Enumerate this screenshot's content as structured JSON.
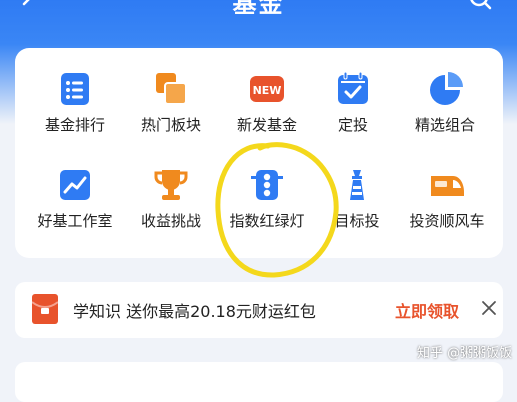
{
  "header": {
    "title": "基金"
  },
  "grid": {
    "items": [
      {
        "label": "基金排行",
        "icon": "ranking-list-icon"
      },
      {
        "label": "热门板块",
        "icon": "hot-sectors-icon"
      },
      {
        "label": "新发基金",
        "icon": "new-fund-icon",
        "badge": "NEW"
      },
      {
        "label": "定投",
        "icon": "calendar-check-icon"
      },
      {
        "label": "精选组合",
        "icon": "pie-chart-icon"
      },
      {
        "label": "好基工作室",
        "icon": "trend-chart-icon"
      },
      {
        "label": "收益挑战",
        "icon": "trophy-icon"
      },
      {
        "label": "指数红绿灯",
        "icon": "traffic-light-icon"
      },
      {
        "label": "目标投",
        "icon": "lighthouse-icon"
      },
      {
        "label": "投资顺风车",
        "icon": "train-icon"
      }
    ]
  },
  "banner": {
    "text": "学知识 送你最高20.18元财运红包",
    "claim": "立即领取"
  },
  "watermark": "知乎 @粥粥饭饭",
  "colors": {
    "primary": "#2f7bf3",
    "orange": "#f08a1e",
    "red": "#e8532c",
    "annotation": "#f4d81c"
  }
}
